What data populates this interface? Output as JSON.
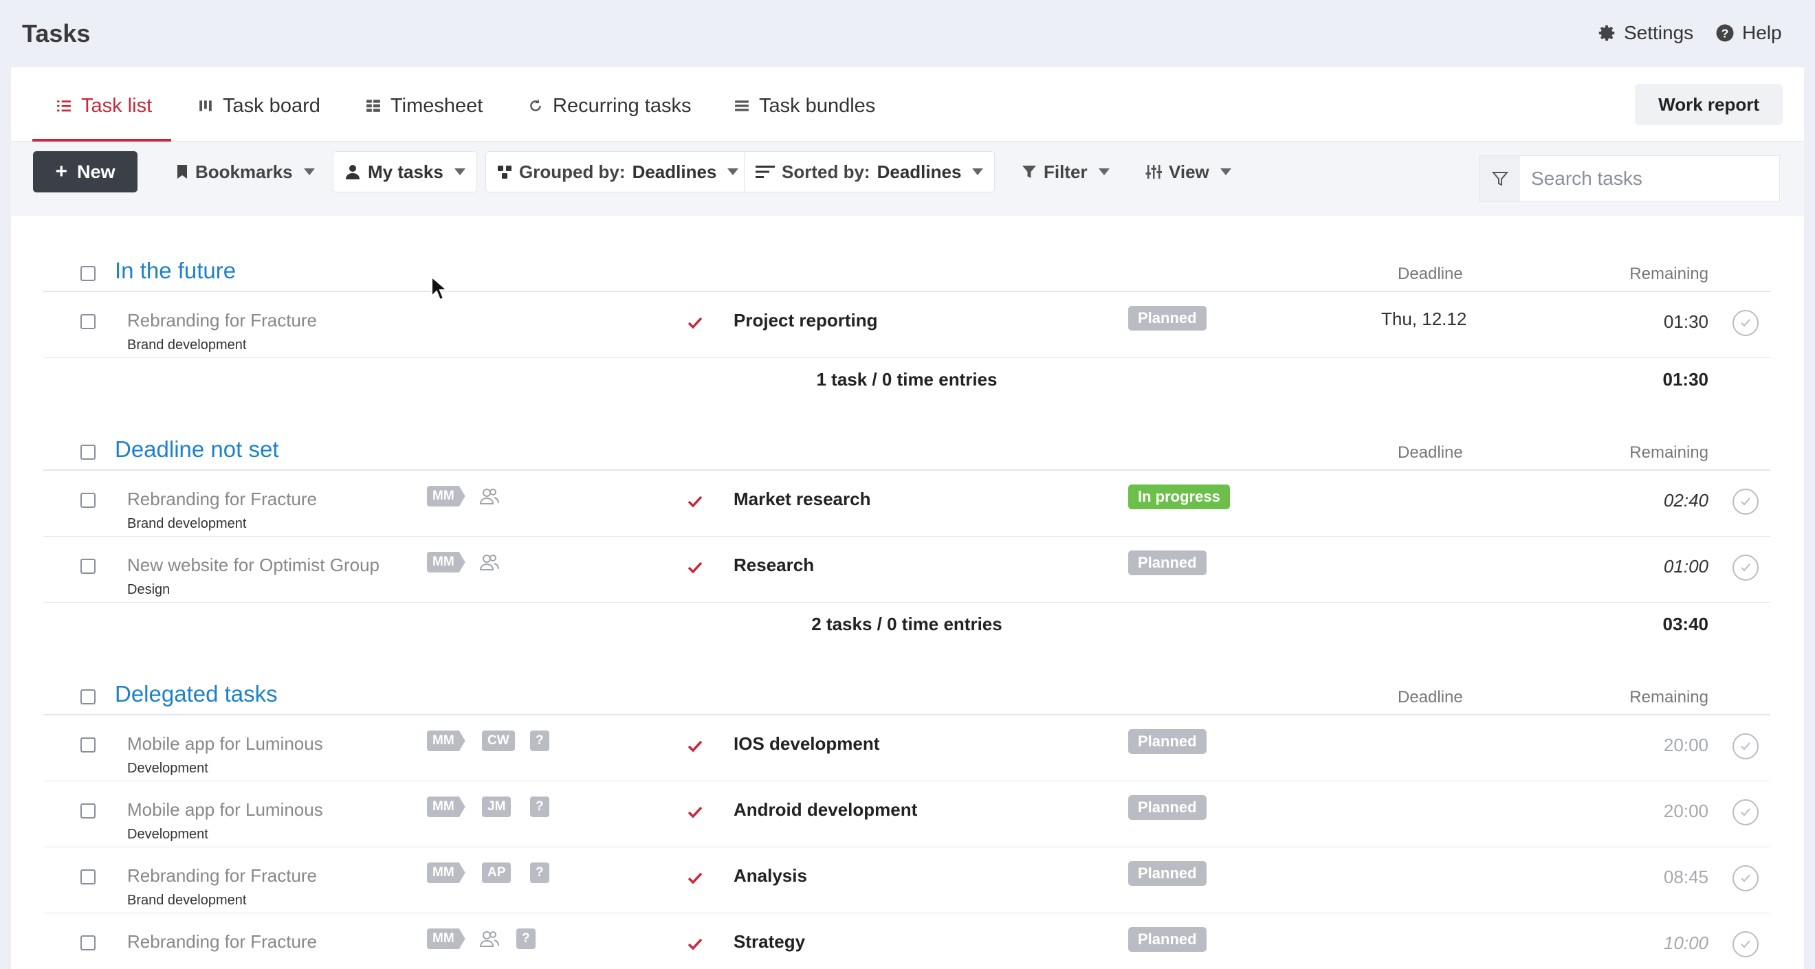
{
  "app": {
    "title": "Tasks"
  },
  "top_links": {
    "settings": "Settings",
    "help": "Help"
  },
  "tabs": [
    {
      "label": "Task list",
      "icon": "list-icon",
      "active": true
    },
    {
      "label": "Task board",
      "icon": "board-icon"
    },
    {
      "label": "Timesheet",
      "icon": "timesheet-icon"
    },
    {
      "label": "Recurring tasks",
      "icon": "recurring-icon"
    },
    {
      "label": "Task bundles",
      "icon": "bundle-icon"
    }
  ],
  "work_report": "Work report",
  "toolbar": {
    "new_label": "New",
    "bookmarks": "Bookmarks",
    "my_tasks": "My tasks",
    "grouped_prefix": "Grouped by:",
    "grouped_value": "Deadlines",
    "sorted_prefix": "Sorted by:",
    "sorted_value": "Deadlines",
    "filter": "Filter",
    "view": "View",
    "search_placeholder": "Search tasks"
  },
  "colors": {
    "accent": "#c8283c",
    "link": "#1d82c9",
    "planned": "#b9bcc3",
    "in_progress": "#6cc04a",
    "new_button": "#3b4048"
  },
  "columns": {
    "deadline": "Deadline",
    "remaining": "Remaining"
  },
  "groups": [
    {
      "title": "In the future",
      "rows": [
        {
          "project": "Rebranding for Fracture",
          "sub": "Brand development",
          "task": "Project reporting",
          "status": "Planned",
          "deadline": "Thu, 12.12",
          "remaining": "01:30"
        }
      ],
      "summary": "1 task / 0 time entries",
      "total": "01:30"
    },
    {
      "title": "Deadline not set",
      "rows": [
        {
          "project": "Rebranding for Fracture",
          "sub": "Brand development",
          "badges": [
            "MM"
          ],
          "task": "Market research",
          "status": "In progress",
          "remaining": "02:40"
        },
        {
          "project": "New website for Optimist Group",
          "sub": "Design",
          "badges": [
            "MM"
          ],
          "task": "Research",
          "status": "Planned",
          "remaining": "01:00"
        }
      ],
      "summary": "2 tasks / 0 time entries",
      "total": "03:40"
    },
    {
      "title": "Delegated tasks",
      "rows": [
        {
          "project": "Mobile app for Luminous",
          "sub": "Development",
          "badges": [
            "MM",
            "CW",
            "?"
          ],
          "task": "IOS development",
          "status": "Planned",
          "remaining": "20:00"
        },
        {
          "project": "Mobile app for Luminous",
          "sub": "Development",
          "badges": [
            "MM",
            "JM",
            "?"
          ],
          "task": "Android development",
          "status": "Planned",
          "remaining": "20:00"
        },
        {
          "project": "Rebranding for Fracture",
          "sub": "Brand development",
          "badges": [
            "MM",
            "AP",
            "?"
          ],
          "task": "Analysis",
          "status": "Planned",
          "remaining": "08:45"
        },
        {
          "project": "Rebranding for Fracture",
          "badges": [
            "MM",
            "?"
          ],
          "task": "Strategy",
          "status": "Planned",
          "remaining": "10:00"
        }
      ]
    }
  ]
}
